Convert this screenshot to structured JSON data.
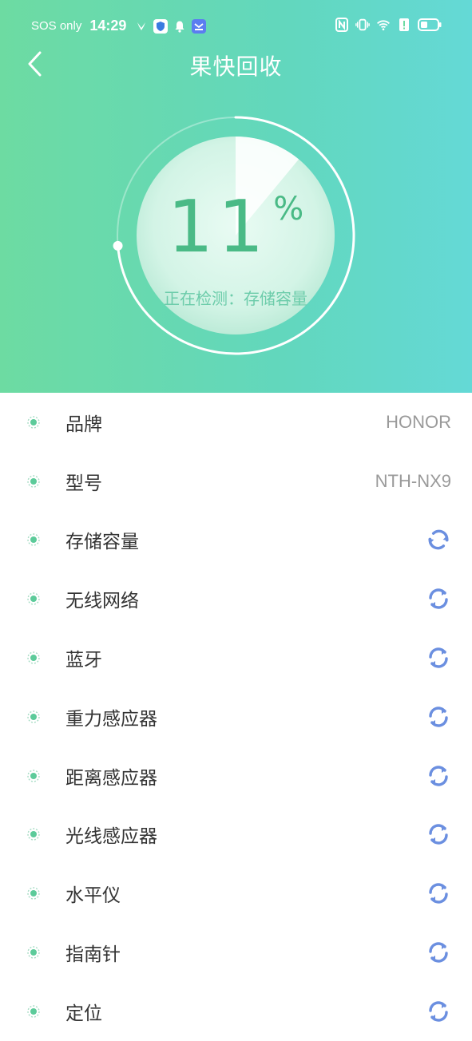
{
  "status_bar": {
    "sos": "SOS only",
    "time": "14:29"
  },
  "header": {
    "title": "果快回收",
    "back_icon": "chevron-left-icon"
  },
  "gauge": {
    "value": "11",
    "unit": "%",
    "progress_percent": 11,
    "label": "正在检测：存储容量"
  },
  "items": [
    {
      "label": "品牌",
      "value": "HONOR"
    },
    {
      "label": "型号",
      "value": "NTH-NX9"
    },
    {
      "label": "存储容量",
      "icon": "refresh-icon",
      "state": "checking"
    },
    {
      "label": "无线网络",
      "icon": "refresh-icon",
      "state": "pending"
    },
    {
      "label": "蓝牙",
      "icon": "refresh-icon",
      "state": "pending"
    },
    {
      "label": "重力感应器",
      "icon": "refresh-icon",
      "state": "pending"
    },
    {
      "label": "距离感应器",
      "icon": "refresh-icon",
      "state": "pending"
    },
    {
      "label": "光线感应器",
      "icon": "refresh-icon",
      "state": "pending"
    },
    {
      "label": "水平仪",
      "icon": "refresh-icon",
      "state": "pending"
    },
    {
      "label": "指南针",
      "icon": "refresh-icon",
      "state": "pending"
    },
    {
      "label": "定位",
      "icon": "refresh-icon",
      "state": "pending"
    }
  ],
  "colors": {
    "header_start": "#6ddba2",
    "header_end": "#64d9d6",
    "accent_green": "#4aba86",
    "refresh_blue": "#6b8fe0"
  }
}
